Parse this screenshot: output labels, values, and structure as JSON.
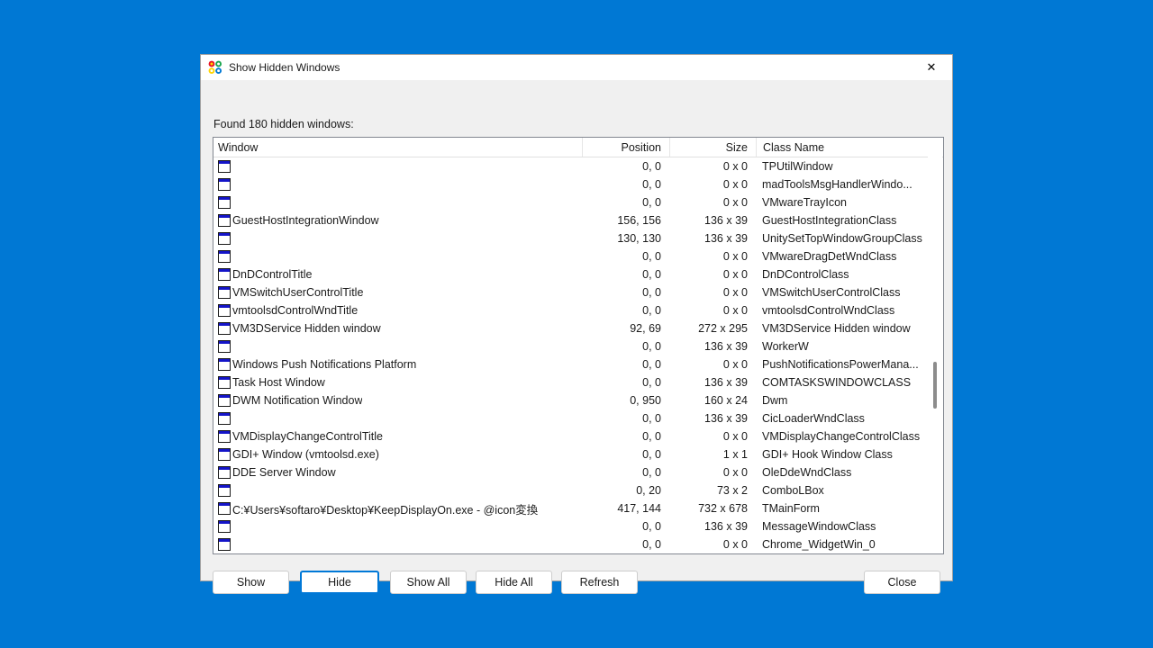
{
  "window": {
    "title": "Show Hidden Windows",
    "app_icon": "four-color-circles-icon",
    "close_label": "✕"
  },
  "status": {
    "text": "Found 180 hidden windows:"
  },
  "list": {
    "columns": [
      {
        "key": "window",
        "label": "Window"
      },
      {
        "key": "position",
        "label": "Position"
      },
      {
        "key": "size",
        "label": "Size"
      },
      {
        "key": "class",
        "label": "Class Name"
      }
    ],
    "rows": [
      {
        "window": "",
        "position": "0, 0",
        "size": "0 x 0",
        "class": "TPUtilWindow"
      },
      {
        "window": "",
        "position": "0, 0",
        "size": "0 x 0",
        "class": "madToolsMsgHandlerWindo..."
      },
      {
        "window": "",
        "position": "0, 0",
        "size": "0 x 0",
        "class": "VMwareTrayIcon"
      },
      {
        "window": "GuestHostIntegrationWindow",
        "position": "156, 156",
        "size": "136 x 39",
        "class": "GuestHostIntegrationClass"
      },
      {
        "window": "",
        "position": "130, 130",
        "size": "136 x 39",
        "class": "UnitySetTopWindowGroupClass"
      },
      {
        "window": "",
        "position": "0, 0",
        "size": "0 x 0",
        "class": "VMwareDragDetWndClass"
      },
      {
        "window": "DnDControlTitle",
        "position": "0, 0",
        "size": "0 x 0",
        "class": "DnDControlClass"
      },
      {
        "window": "VMSwitchUserControlTitle",
        "position": "0, 0",
        "size": "0 x 0",
        "class": "VMSwitchUserControlClass"
      },
      {
        "window": "vmtoolsdControlWndTitle",
        "position": "0, 0",
        "size": "0 x 0",
        "class": "vmtoolsdControlWndClass"
      },
      {
        "window": "VM3DService Hidden window",
        "position": "92, 69",
        "size": "272 x 295",
        "class": "VM3DService Hidden window"
      },
      {
        "window": "",
        "position": "0, 0",
        "size": "136 x 39",
        "class": "WorkerW"
      },
      {
        "window": "Windows Push Notifications Platform",
        "position": "0, 0",
        "size": "0 x 0",
        "class": "PushNotificationsPowerMana..."
      },
      {
        "window": "Task Host Window",
        "position": "0, 0",
        "size": "136 x 39",
        "class": "COMTASKSWINDOWCLASS"
      },
      {
        "window": "DWM Notification Window",
        "position": "0, 950",
        "size": "160 x 24",
        "class": "Dwm"
      },
      {
        "window": "",
        "position": "0, 0",
        "size": "136 x 39",
        "class": "CicLoaderWndClass"
      },
      {
        "window": "VMDisplayChangeControlTitle",
        "position": "0, 0",
        "size": "0 x 0",
        "class": "VMDisplayChangeControlClass"
      },
      {
        "window": "GDI+ Window (vmtoolsd.exe)",
        "position": "0, 0",
        "size": "1 x 1",
        "class": "GDI+ Hook Window Class"
      },
      {
        "window": "DDE Server Window",
        "position": "0, 0",
        "size": "0 x 0",
        "class": "OleDdeWndClass"
      },
      {
        "window": "",
        "position": "0, 20",
        "size": "73 x 2",
        "class": "ComboLBox"
      },
      {
        "window": "C:¥Users¥softaro¥Desktop¥KeepDisplayOn.exe - @icon変換",
        "position": "417, 144",
        "size": "732 x 678",
        "class": "TMainForm"
      },
      {
        "window": "",
        "position": "0, 0",
        "size": "136 x 39",
        "class": "MessageWindowClass"
      },
      {
        "window": "",
        "position": "0, 0",
        "size": "0 x 0",
        "class": "Chrome_WidgetWin_0"
      },
      {
        "window": "",
        "position": "",
        "size": "",
        "class": ""
      }
    ]
  },
  "buttons": {
    "show": "Show",
    "hide": "Hide",
    "show_all": "Show All",
    "hide_all": "Hide All",
    "refresh": "Refresh",
    "close": "Close"
  },
  "colors": {
    "desktop": "#0078d4",
    "accent": "#0078d7",
    "dialog_bg": "#f0f0f0",
    "list_bg": "#ffffff",
    "icon_blue": "#1414c8"
  }
}
